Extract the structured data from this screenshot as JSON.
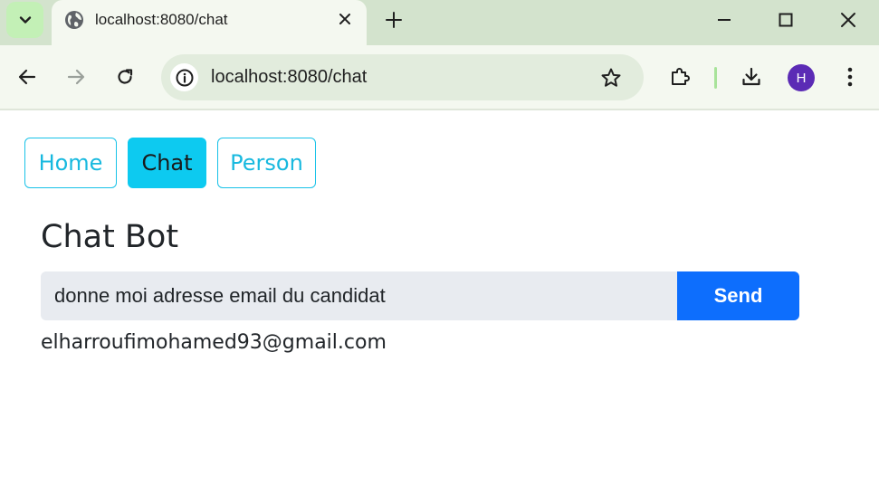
{
  "browser": {
    "tab_title": "localhost:8080/chat",
    "url": "localhost:8080/chat",
    "profile_initial": "H",
    "icons": {
      "tab_search": "chevron-down-icon",
      "favicon": "globe-icon",
      "tab_close": "close-icon",
      "new_tab": "plus-icon",
      "minimize": "minimize-icon",
      "maximize": "maximize-icon",
      "window_close": "close-icon",
      "back": "arrow-left-icon",
      "forward": "arrow-right-icon",
      "reload": "reload-icon",
      "site_info": "info-icon",
      "bookmark": "star-icon",
      "extensions": "puzzle-icon",
      "downloads": "download-icon",
      "menu": "kebab-menu-icon"
    },
    "colors": {
      "tabstrip": "#d3e3cd",
      "toolbar": "#f4f8f0",
      "avatar": "#5b2bb5"
    }
  },
  "nav": {
    "items": [
      {
        "label": "Home",
        "active": false
      },
      {
        "label": "Chat",
        "active": true
      },
      {
        "label": "Person",
        "active": false
      }
    ]
  },
  "chat": {
    "title": "Chat Bot",
    "input_value": "donne moi adresse email du candidat",
    "send_label": "Send",
    "response": "elharroufimohamed93@gmail.com"
  },
  "colors": {
    "nav_accent": "#0dcaf0",
    "send_button": "#0d6efd",
    "input_bg": "#e8ebf0"
  }
}
